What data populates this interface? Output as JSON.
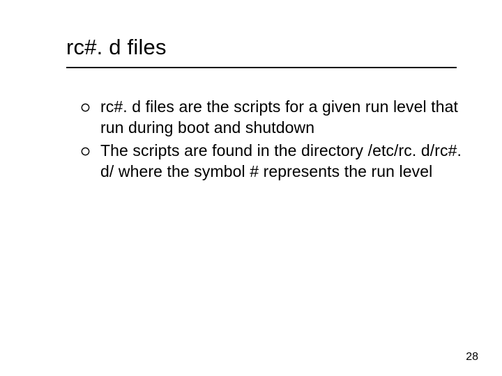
{
  "slide": {
    "title": "rc#. d files",
    "bullets": [
      {
        "text": "rc#. d files are the scripts for a given run level that run during boot and shutdown"
      },
      {
        "text": "The scripts are found in the directory /etc/rc. d/rc#. d/ where the symbol # represents the run level"
      }
    ],
    "page_number": "28"
  }
}
